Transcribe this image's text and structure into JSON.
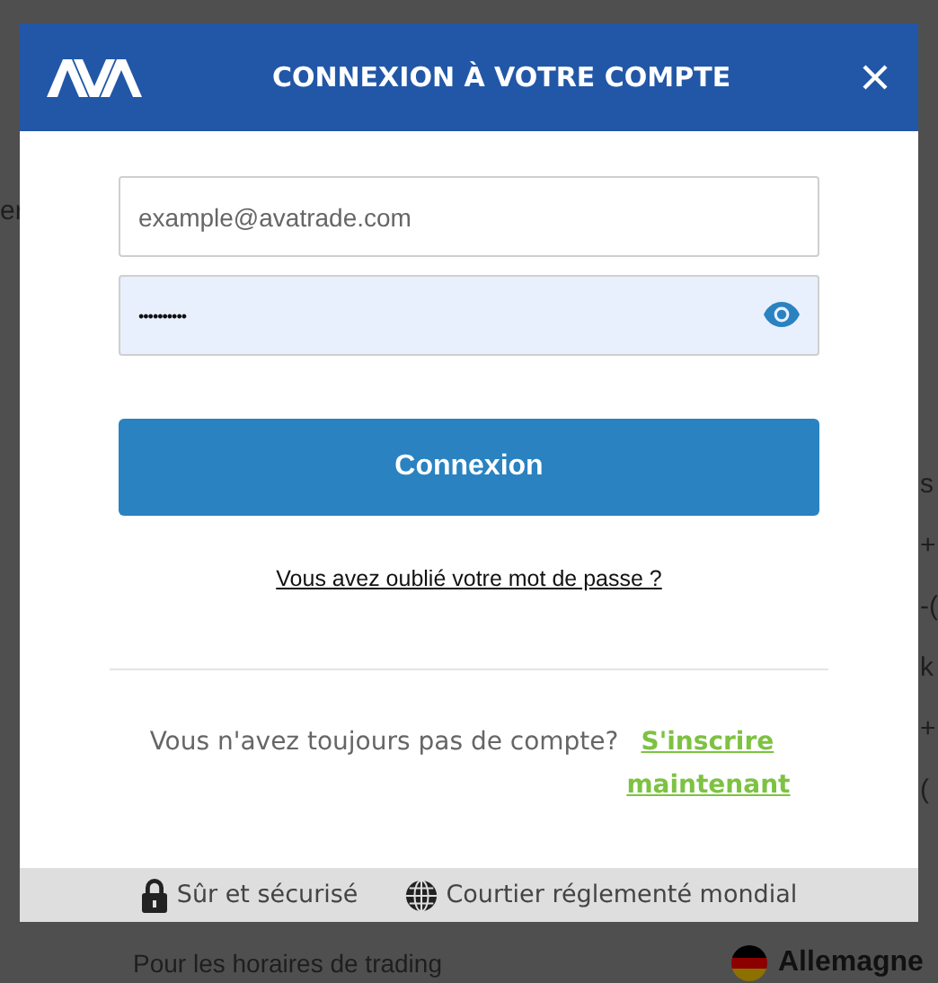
{
  "background": {
    "left_fragments": [
      "er"
    ],
    "right_fragments": [
      "s",
      "+",
      "-(",
      "k",
      "+",
      "("
    ],
    "trading_note": "Pour les horaires de trading",
    "country": "Allemagne"
  },
  "dialog": {
    "title": "CONNEXION À VOTRE COMPTE",
    "email": {
      "placeholder": "example@avatrade.com"
    },
    "password": {
      "value": "••••••••••"
    },
    "submit": "Connexion",
    "forgot_link": "Vous avez oublié votre mot de passe ?",
    "signup_prompt": "Vous n'avez toujours pas de compte?",
    "signup_link": "S'inscrire maintenant",
    "badges": [
      {
        "kind": "lock",
        "label": "Sûr et sécurisé"
      },
      {
        "kind": "globe",
        "label": "Courtier réglementé mondial"
      }
    ]
  }
}
